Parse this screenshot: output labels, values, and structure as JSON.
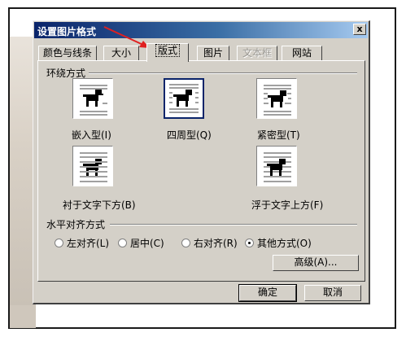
{
  "dialog": {
    "title": "设置图片格式",
    "close_glyph": "x"
  },
  "tabs": [
    {
      "label": "颜色与线条",
      "state": "normal"
    },
    {
      "label": "大小",
      "state": "normal"
    },
    {
      "label": "版式",
      "state": "active"
    },
    {
      "label": "图片",
      "state": "normal"
    },
    {
      "label": "文本框",
      "state": "disabled"
    },
    {
      "label": "网站",
      "state": "normal"
    }
  ],
  "wrap": {
    "group_label": "环绕方式",
    "options": [
      {
        "label": "嵌入型(I)",
        "icon": "inline-wrap-icon",
        "selected": false
      },
      {
        "label": "四周型(Q)",
        "icon": "square-wrap-icon",
        "selected": true
      },
      {
        "label": "紧密型(T)",
        "icon": "tight-wrap-icon",
        "selected": false
      },
      {
        "label": "衬于文字下方(B)",
        "icon": "behind-text-icon",
        "selected": false
      },
      {
        "label": "浮于文字上方(F)",
        "icon": "in-front-of-text-icon",
        "selected": false
      }
    ]
  },
  "align": {
    "group_label": "水平对齐方式",
    "options": [
      {
        "label": "左对齐(L)",
        "checked": false
      },
      {
        "label": "居中(C)",
        "checked": false
      },
      {
        "label": "右对齐(R)",
        "checked": false
      },
      {
        "label": "其他方式(O)",
        "checked": true
      }
    ]
  },
  "buttons": {
    "advanced": "高级(A)...",
    "ok": "确定",
    "cancel": "取消"
  },
  "colors": {
    "dialog_bg": "#d4d0c8",
    "title_gradient_start": "#0a246a",
    "title_gradient_end": "#a6caf0",
    "annotation_arrow": "#e02020"
  }
}
